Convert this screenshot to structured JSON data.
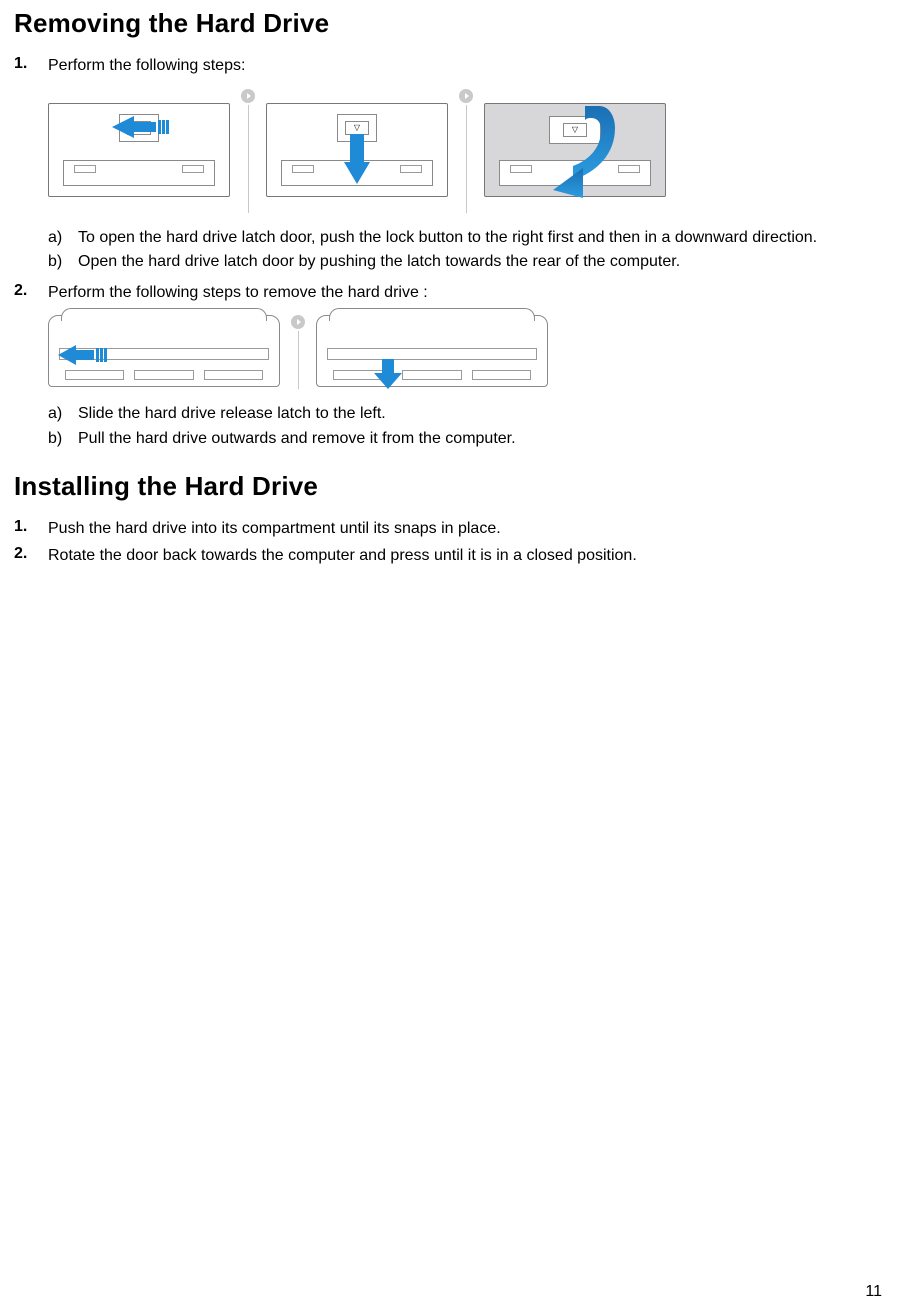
{
  "section1": {
    "title": "Removing the Hard Drive",
    "steps": [
      {
        "num": "1.",
        "text": "Perform the following steps:",
        "sub": [
          {
            "letter": "a)",
            "text": "To open the hard drive latch door, push the lock button to the right first and then in a downward direction."
          },
          {
            "letter": "b)",
            "text": "Open the hard drive latch door by pushing the latch towards the rear of the computer."
          }
        ]
      },
      {
        "num": "2.",
        "text": "Perform the following steps to remove the hard drive :",
        "sub": [
          {
            "letter": "a)",
            "text": "Slide the hard drive release latch to the left."
          },
          {
            "letter": "b)",
            "text": "Pull the hard drive outwards and remove it from the computer."
          }
        ]
      }
    ]
  },
  "section2": {
    "title": "Installing the Hard Drive",
    "steps": [
      {
        "num": "1.",
        "text": "Push the hard drive into its compartment until its snaps in place."
      },
      {
        "num": "2.",
        "text": "Rotate the door back towards the computer and press until it is in a closed position."
      }
    ]
  },
  "page_number": "11"
}
